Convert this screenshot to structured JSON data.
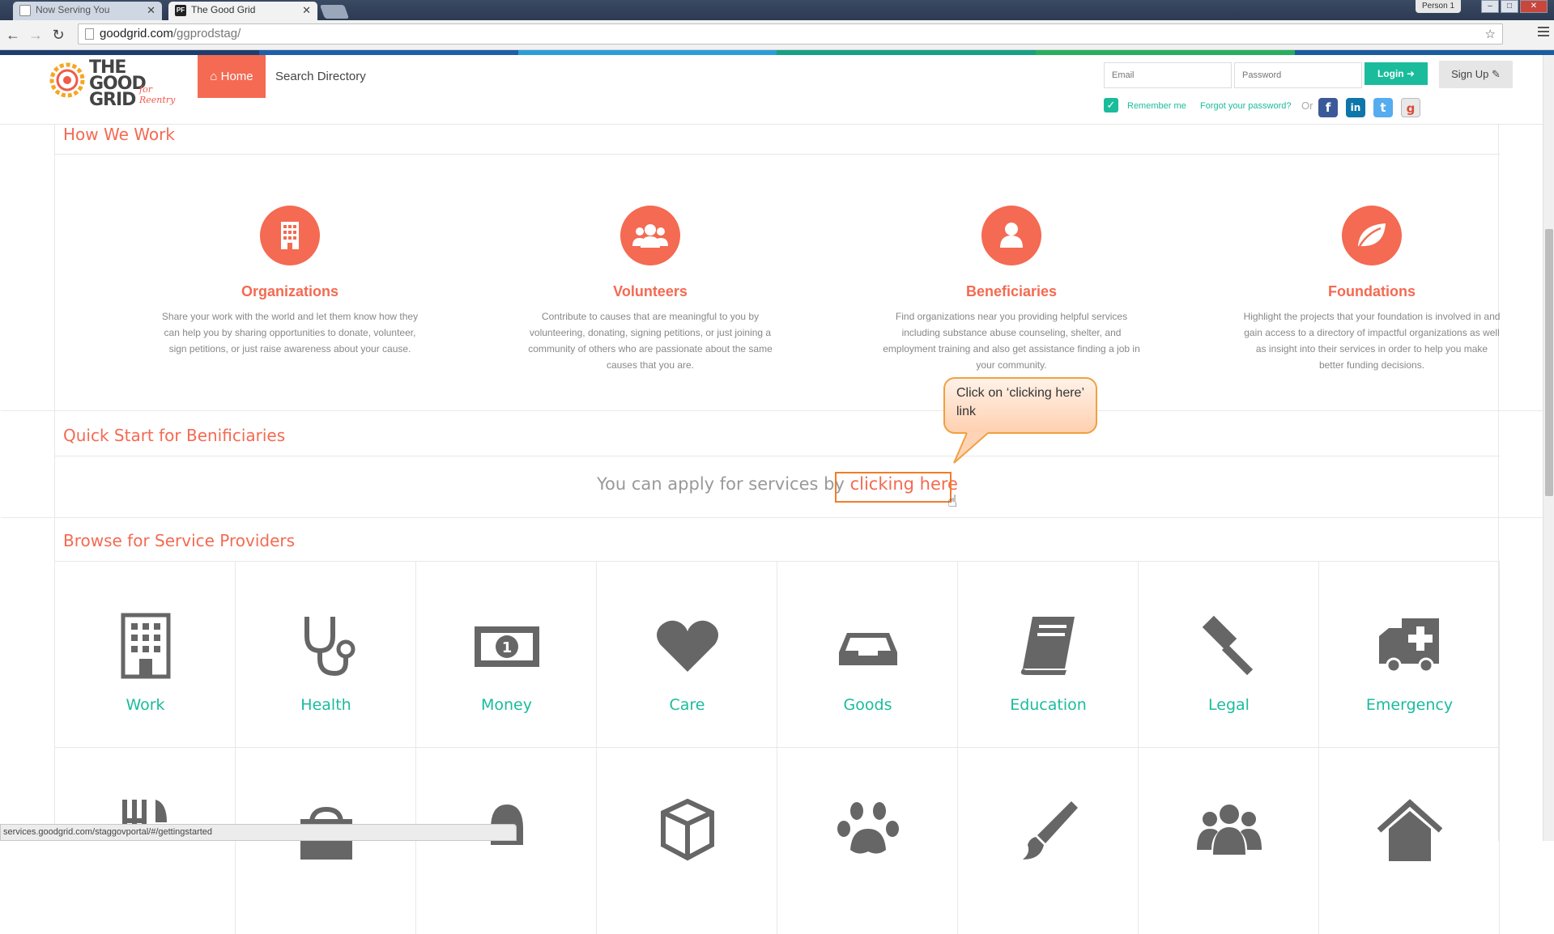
{
  "browser": {
    "tabs": [
      {
        "title": "Now Serving You",
        "favicon": "page-icon",
        "active": false
      },
      {
        "title": "The Good Grid",
        "favicon": "PF",
        "active": true
      }
    ],
    "profile": "Person 1",
    "url_host": "goodgrid.com",
    "url_path": "/ggprodstag/",
    "status_url": "services.goodgrid.com/staggovportal/#/gettingstarted"
  },
  "header": {
    "logo_text_line1": "THE GOOD",
    "logo_text_line2": "GRID",
    "logo_sub": "for Reentry",
    "nav": {
      "home": "Home",
      "search": "Search Directory"
    },
    "login": {
      "email_placeholder": "Email",
      "password_placeholder": "Password",
      "login_label": "Login",
      "signup_label": "Sign Up",
      "remember": "Remember me",
      "forgot": "Forgot your password?",
      "or": "Or"
    },
    "social": [
      "f",
      "in",
      "t",
      "g"
    ]
  },
  "how_we_work": {
    "title": "How We Work",
    "items": [
      {
        "title": "Organizations",
        "icon": "building-icon",
        "desc": "Share your work with the world and let them know how they can help you by sharing opportunities to donate, volunteer, sign petitions, or just raise awareness about your cause."
      },
      {
        "title": "Volunteers",
        "icon": "group-icon",
        "desc": "Contribute to causes that are meaningful to you by volunteering, donating, signing petitions, or just joining a community of others who are passionate about the same causes that you are."
      },
      {
        "title": "Beneficiaries",
        "icon": "user-icon",
        "desc": "Find organizations near you providing helpful services including substance abuse counseling, shelter, and employment training and also get assistance finding a job in your community."
      },
      {
        "title": "Foundations",
        "icon": "leaf-icon",
        "desc": "Highlight the projects that your foundation is involved in and gain access to a directory of impactful organizations as well as insight into their services in order to help you make better funding decisions."
      }
    ]
  },
  "quick_start": {
    "title": "Quick Start for Benificiaries",
    "apply_prefix": "You can apply for services by ",
    "apply_link": "clicking here"
  },
  "callout": {
    "text": "Click on ‘clicking here’ link"
  },
  "browse": {
    "title": "Browse for Service Providers",
    "categories": [
      {
        "label": "Work",
        "icon": "building-icon"
      },
      {
        "label": "Health",
        "icon": "stethoscope-icon"
      },
      {
        "label": "Money",
        "icon": "money-icon"
      },
      {
        "label": "Care",
        "icon": "heart-icon"
      },
      {
        "label": "Goods",
        "icon": "inbox-icon"
      },
      {
        "label": "Education",
        "icon": "book-icon"
      },
      {
        "label": "Legal",
        "icon": "gavel-icon"
      },
      {
        "label": "Emergency",
        "icon": "ambulance-icon"
      }
    ],
    "row2_icons": [
      "food-icon",
      "bag-icon",
      "bell-icon",
      "cube-icon",
      "paw-icon",
      "brush-icon",
      "group-icon",
      "home-icon"
    ]
  },
  "colors": {
    "accent": "#f46a52",
    "teal": "#1abc9c",
    "colorbar": [
      "#1d3d6e",
      "#1d5fa8",
      "#2a9dd8",
      "#16a085",
      "#27ae60",
      "#1a5c9e"
    ]
  }
}
